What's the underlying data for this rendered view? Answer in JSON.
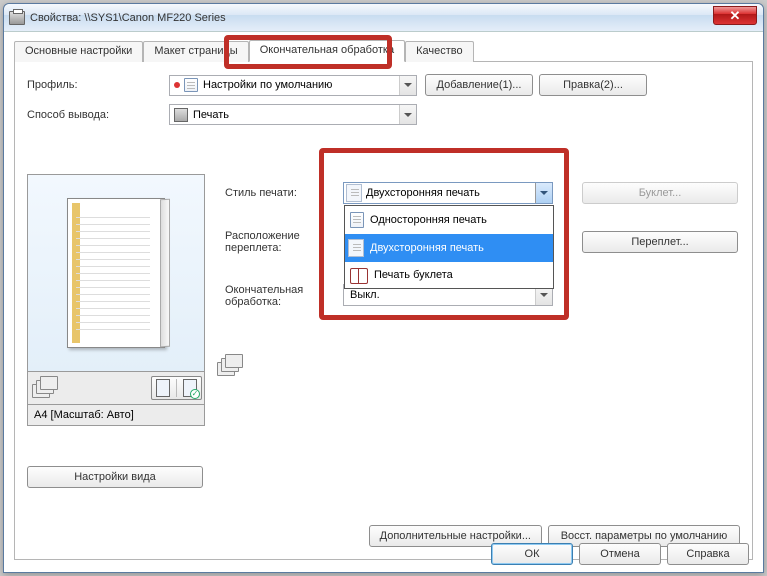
{
  "window": {
    "title": "Свойства: \\\\SYS1\\Canon MF220 Series"
  },
  "tabs": {
    "basic": "Основные настройки",
    "layout": "Макет страницы",
    "finishing": "Окончательная обработка",
    "quality": "Качество"
  },
  "profile": {
    "label": "Профиль:",
    "value": "Настройки по умолчанию"
  },
  "output": {
    "label": "Способ вывода:",
    "value": "Печать"
  },
  "buttons": {
    "add": "Добавление(1)...",
    "edit": "Правка(2)...",
    "booklet": "Буклет...",
    "binding": "Переплет...",
    "view_settings": "Настройки вида",
    "advanced": "Дополнительные настройки...",
    "restore": "Восст. параметры по умолчанию",
    "ok": "ОК",
    "cancel": "Отмена",
    "help": "Справка"
  },
  "labels": {
    "print_style": "Стиль печати:",
    "binding_pos": "Расположение переплета:",
    "finishing": "Окончательная обработка:",
    "preview_caption": "A4 [Масштаб: Авто]"
  },
  "print_style": {
    "selected": "Двухсторонняя печать",
    "options": {
      "single": "Односторонняя печать",
      "double": "Двухсторонняя печать",
      "booklet": "Печать буклета"
    }
  },
  "finishing": {
    "value": "Выкл."
  }
}
